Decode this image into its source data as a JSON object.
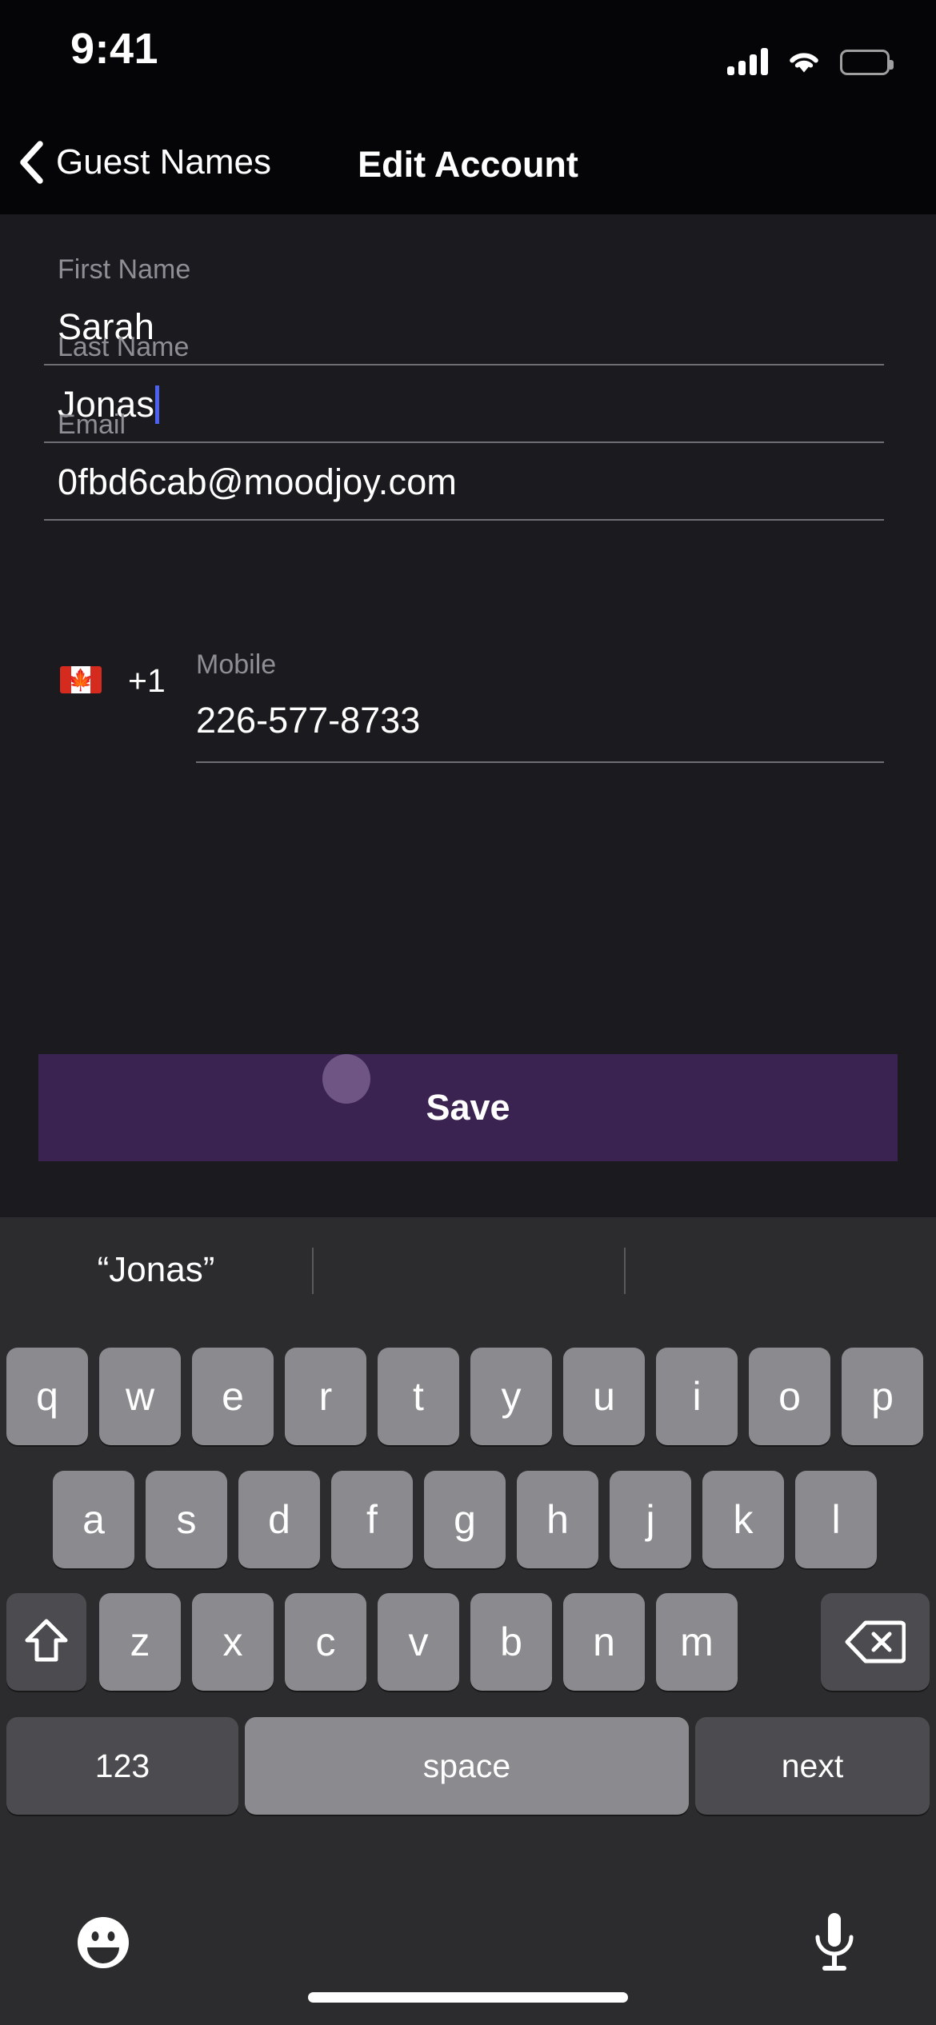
{
  "status_bar": {
    "time": "9:41",
    "cellular_icon": "cellular-signal-icon",
    "wifi_icon": "wifi-icon",
    "battery_icon": "battery-full-icon"
  },
  "nav_bar": {
    "back_icon": "chevron-left-icon",
    "back_label": "Guest Names",
    "title": "Edit Account"
  },
  "form": {
    "first_name": {
      "label": "First Name",
      "value": "Sarah"
    },
    "last_name": {
      "label": "Last Name",
      "value": "Jonas",
      "focused": true
    },
    "email": {
      "label": "Email",
      "value": "0fbd6cab@moodjoy.com"
    },
    "mobile": {
      "label": "Mobile",
      "value": "226-577-8733",
      "country_code": "+1",
      "flag_icon": "canada-flag-icon",
      "flag_glyph": "🍁"
    }
  },
  "save": {
    "label": "Save",
    "color": "#3A2351",
    "touch_dot_color": "#6E5584"
  },
  "keyboard": {
    "predictions": [
      "“Jonas”",
      "",
      ""
    ],
    "row1": [
      "q",
      "w",
      "e",
      "r",
      "t",
      "y",
      "u",
      "i",
      "o",
      "p"
    ],
    "row2": [
      "a",
      "s",
      "d",
      "f",
      "g",
      "h",
      "j",
      "k",
      "l"
    ],
    "row3": [
      "z",
      "x",
      "c",
      "v",
      "b",
      "n",
      "m"
    ],
    "shift_icon": "shift-arrow-icon",
    "backspace_icon": "backspace-icon",
    "numbers_label": "123",
    "space_label": "space",
    "return_label": "next",
    "emoji_icon": "emoji-smiley-icon",
    "mic_icon": "microphone-icon",
    "key_color": "#8A8A8F",
    "fn_key_color": "#4C4C50",
    "background": "#2C2C2E"
  }
}
